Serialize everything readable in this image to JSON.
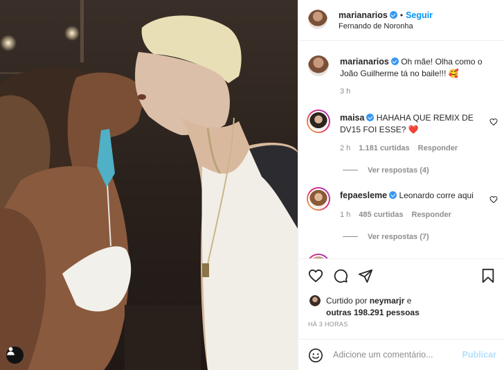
{
  "post": {
    "author": "marianarios",
    "follow_label": "Seguir",
    "dot": "•",
    "location": "Fernando de Noronha"
  },
  "caption": {
    "author": "marianarios",
    "text": "Oh mãe! Olha como o João Guilherme tá no baile!!! 🥰",
    "time": "3 h"
  },
  "comments": [
    {
      "author": "maisa",
      "text": "HAHAHA QUE REMIX DE DV15 FOI ESSE? ❤️",
      "time": "2 h",
      "likes": "1.181 curtidas",
      "reply_label": "Responder",
      "view_replies": "Ver respostas (4)"
    },
    {
      "author": "fepaesleme",
      "text": "Leonardo corre aqui",
      "time": "1 h",
      "likes": "485 curtidas",
      "reply_label": "Responder",
      "view_replies": "Ver respostas (7)"
    }
  ],
  "likes_summary": {
    "prefix": "Curtido por",
    "user": "neymarjr",
    "suffix": "e",
    "others": "outras 198.291 pessoas"
  },
  "posted_ago": "HÁ 3 HORAS",
  "add_comment": {
    "placeholder": "Adicione um comentário...",
    "publish_label": "Publicar"
  },
  "icons": {
    "like": "heart-icon",
    "comment": "comment-icon",
    "share": "send-icon",
    "save": "bookmark-icon",
    "emoji": "emoji-icon",
    "tags": "user-tag-icon"
  },
  "colors": {
    "link": "#0095f6",
    "publish_disabled": "#b2dffc",
    "verified": "#3897f0",
    "secondary_text": "#8e8e8e"
  }
}
